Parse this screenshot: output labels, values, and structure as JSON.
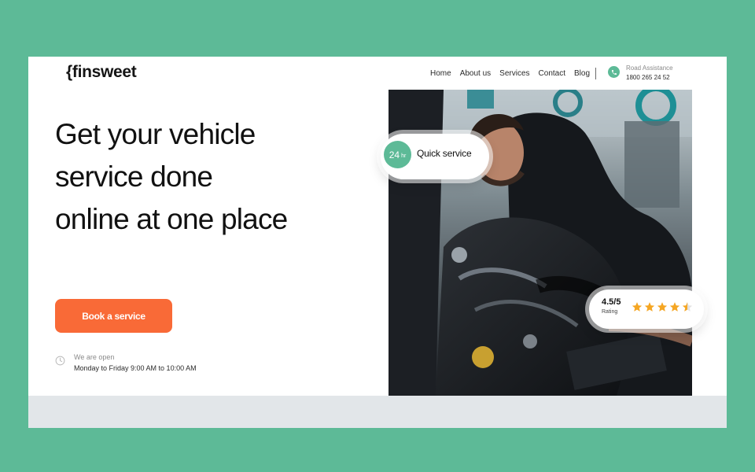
{
  "brand": {
    "logo_text": "{finsweet"
  },
  "nav": {
    "items": [
      "Home",
      "About us",
      "Services",
      "Contact",
      "Blog"
    ]
  },
  "contact": {
    "label": "Road Assistance",
    "phone": "1800 265 24 52"
  },
  "hero": {
    "title": "Get your vehicle service done online at one place",
    "cta_label": "Book a service",
    "open_label": "We are open",
    "open_hours": "Monday to Friday 9:00 AM to 10:00 AM"
  },
  "badges": {
    "quick": {
      "number": "24",
      "unit": "hr",
      "text": "Quick service"
    },
    "rating": {
      "value": "4.5/5",
      "label": "Rating",
      "stars": 4.5
    }
  },
  "colors": {
    "background": "#5dba97",
    "accent_green": "#5dba97",
    "cta_orange": "#f96a37",
    "star": "#f5a623",
    "bottom_band": "#e2e6e9"
  },
  "icons": {
    "phone": "phone-icon",
    "clock": "clock-icon",
    "star": "star-icon"
  }
}
